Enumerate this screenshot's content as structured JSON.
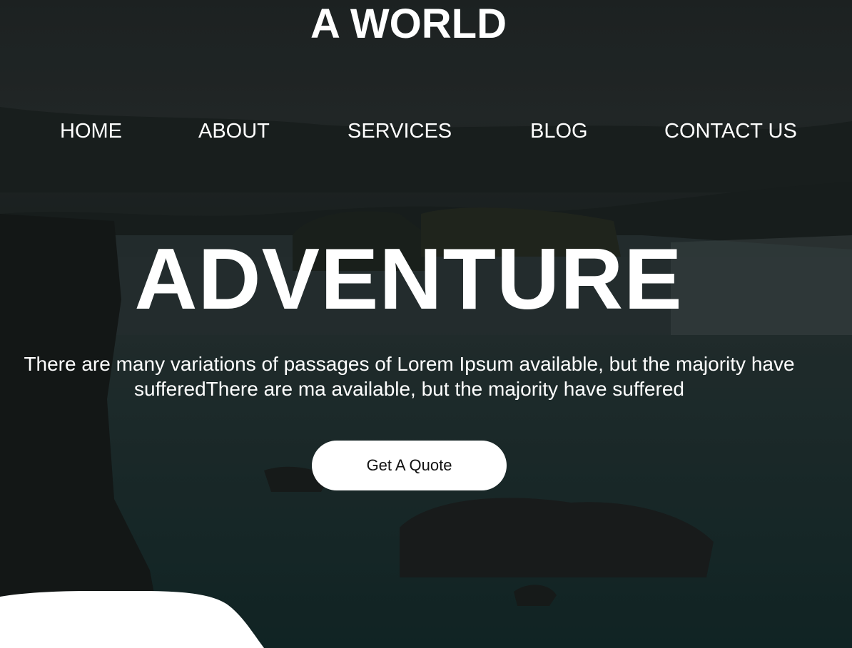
{
  "brand": {
    "title": "A WORLD"
  },
  "nav": {
    "items": [
      {
        "label": "HOME"
      },
      {
        "label": "ABOUT"
      },
      {
        "label": "SERVICES"
      },
      {
        "label": "BLOG"
      },
      {
        "label": "CONTACT US"
      }
    ]
  },
  "hero": {
    "headline": "ADVENTURE",
    "tagline": "There are many variations of passages of Lorem Ipsum available, but the majority have sufferedThere are ma available, but the majority have suffered",
    "cta_label": "Get A Quote"
  },
  "colors": {
    "overlay": "#1b2424",
    "text": "#ffffff",
    "button_bg": "#ffffff",
    "button_text": "#111111"
  }
}
